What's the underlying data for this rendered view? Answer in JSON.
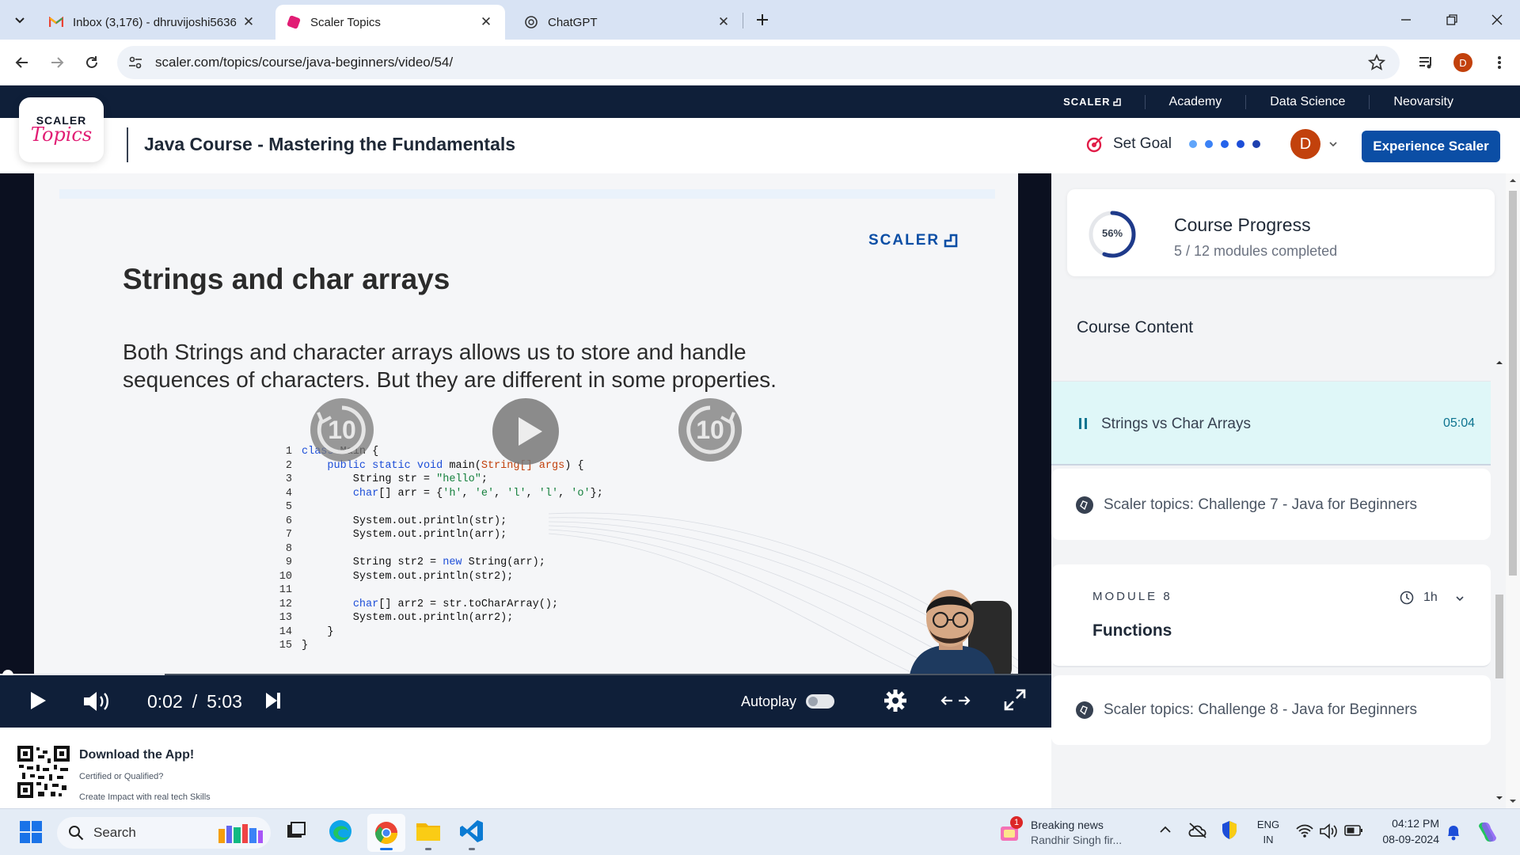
{
  "browser": {
    "tabs": [
      {
        "title": "Inbox (3,176) - dhruvijoshi5636",
        "icon": "gmail-icon"
      },
      {
        "title": "Scaler Topics",
        "icon": "scaler-favicon"
      },
      {
        "title": "ChatGPT",
        "icon": "chatgpt-icon"
      }
    ],
    "url": "scaler.com/topics/course/java-beginners/video/54/",
    "profile_initial": "D"
  },
  "topnav": {
    "brand": "SCALER",
    "items": [
      "Academy",
      "Data Science",
      "Neovarsity"
    ]
  },
  "header": {
    "logo_top": "SCALER",
    "logo_bottom": "Topics",
    "course_title": "Java Course - Mastering the Fundamentals",
    "set_goal": "Set Goal",
    "avatar_initial": "D",
    "cta": "Experience Scaler"
  },
  "slide": {
    "brand": "SCALER",
    "heading": "Strings and char arrays",
    "body_line1": "Both Strings and character arrays allows us to store and handle",
    "body_line2": "sequences of characters. But they are different in some properties.",
    "code": [
      "class Main {",
      "    public static void main(String[] args) {",
      "        String str = \"hello\";",
      "        char[] arr = {'h', 'e', 'l', 'l', 'o'};",
      "",
      "        System.out.println(str);",
      "        System.out.println(arr);",
      "",
      "        String str2 = new String(arr);",
      "        System.out.println(str2);",
      "",
      "        char[] arr2 = str.toCharArray();",
      "        System.out.println(arr2);",
      "    }",
      "}"
    ],
    "skip_back": "10",
    "skip_fwd": "10"
  },
  "player": {
    "current": "0:02",
    "separator": "/",
    "duration": "5:03",
    "autoplay_label": "Autoplay",
    "autoplay_on": false,
    "progress": 0.157
  },
  "sidebar": {
    "progress_percent": "56%",
    "progress_value": 0.56,
    "progress_title": "Course Progress",
    "progress_sub": "5 / 12 modules completed",
    "content_title": "Course Content",
    "current_item": {
      "title": "Strings vs Char Arrays",
      "duration": "05:04"
    },
    "challenge7": "Scaler topics: Challenge 7 - Java for Beginners",
    "module": {
      "label": "MODULE 8",
      "duration": "1h",
      "name": "Functions"
    },
    "challenge8": "Scaler topics: Challenge 8 - Java for Beginners"
  },
  "app_download": {
    "title": "Download the App!",
    "line1": "Certified or Qualified?",
    "line2": "Create Impact with real tech Skills"
  },
  "taskbar": {
    "search": "Search",
    "news_title": "Breaking news",
    "news_sub": "Randhir Singh fir...",
    "news_badge": "1",
    "lang1": "ENG",
    "lang2": "IN",
    "time": "04:12 PM",
    "date": "08-09-2024"
  },
  "colors": {
    "brand_navy": "#0f1f39",
    "brand_blue": "#0b4ea5",
    "accent_cyan": "#0e7490",
    "active_row": "#dff7f8"
  }
}
